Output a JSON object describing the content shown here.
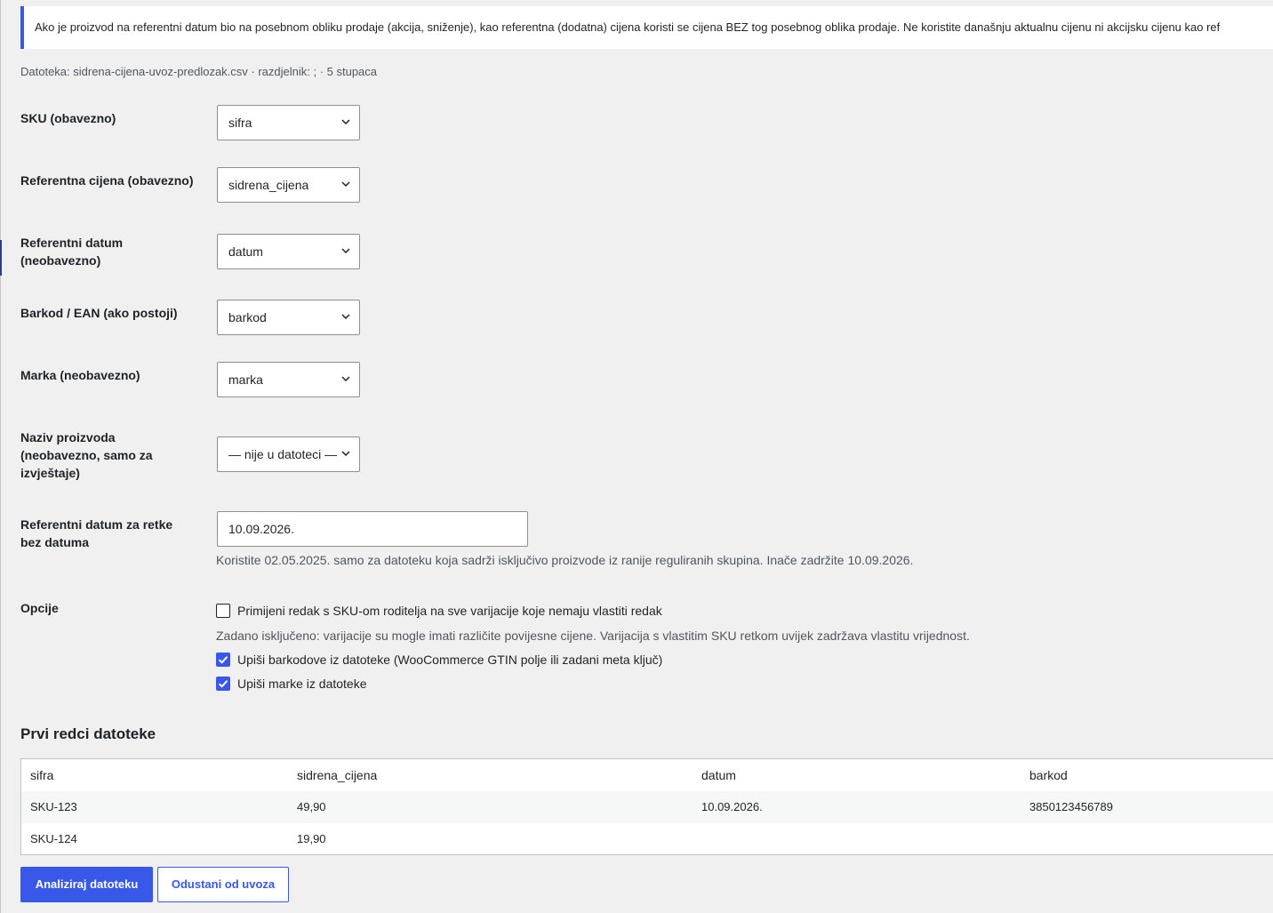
{
  "notice": {
    "text": "Ako je proizvod na referentni datum bio na posebnom obliku prodaje (akcija, sniženje), kao referentna (dodatna) cijena koristi se cijena BEZ tog posebnog oblika prodaje. Ne koristite današnju aktualnu cijenu ni akcijsku cijenu kao ref"
  },
  "file_meta": "Datoteka: sidrena-cijena-uvoz-predlozak.csv · razdjelnik: ; · 5 stupaca",
  "fields": {
    "sku": {
      "label": "SKU (obavezno)",
      "value": "sifra"
    },
    "ref_price": {
      "label": "Referentna cijena (obavezno)",
      "value": "sidrena_cijena"
    },
    "ref_date": {
      "label_line1": "Referentni datum",
      "label_line2": "(neobavezno)",
      "value": "datum"
    },
    "barcode": {
      "label": "Barkod / EAN (ako postoji)",
      "value": "barkod"
    },
    "brand": {
      "label": "Marka (neobavezno)",
      "value": "marka"
    },
    "product_name": {
      "label_line1": "Naziv proizvoda",
      "label_line2": "(neobavezno, samo za",
      "label_line3": "izvještaje)",
      "value": "— nije u datoteci —"
    },
    "default_date": {
      "label_line1": "Referentni datum za retke",
      "label_line2": "bez datuma",
      "value": "10.09.2026.",
      "help": "Koristite 02.05.2025. samo za datoteku koja sadrži isključivo proizvode iz ranije reguliranih skupina. Inače zadržite 10.09.2026."
    }
  },
  "options": {
    "label": "Opcije",
    "apply_parent": {
      "label": "Primijeni redak s SKU-om roditelja na sve varijacije koje nemaju vlastiti redak",
      "checked": false
    },
    "apply_parent_help": "Zadano isključeno: varijacije su mogle imati različite povijesne cijene. Varijacija s vlastitim SKU retkom uvijek zadržava vlastitu vrijednost.",
    "write_barcodes": {
      "label": "Upiši barkodove iz datoteke (WooCommerce GTIN polje ili zadani meta ključ)",
      "checked": true
    },
    "write_brands": {
      "label": "Upiši marke iz datoteke",
      "checked": true
    }
  },
  "preview": {
    "title": "Prvi redci datoteke",
    "headers": [
      "sifra",
      "sidrena_cijena",
      "datum",
      "barkod"
    ],
    "rows": [
      [
        "SKU-123",
        "49,90",
        "10.09.2026.",
        "3850123456789"
      ],
      [
        "SKU-124",
        "19,90",
        "",
        ""
      ]
    ]
  },
  "buttons": {
    "analyze": "Analiziraj datoteku",
    "cancel": "Odustani od uvoza"
  },
  "colors": {
    "accent": "#3858e9",
    "background": "#f0f0f1"
  },
  "icons": {
    "select_chevron": "chevron-down-icon",
    "checkmark": "checkmark-icon"
  }
}
